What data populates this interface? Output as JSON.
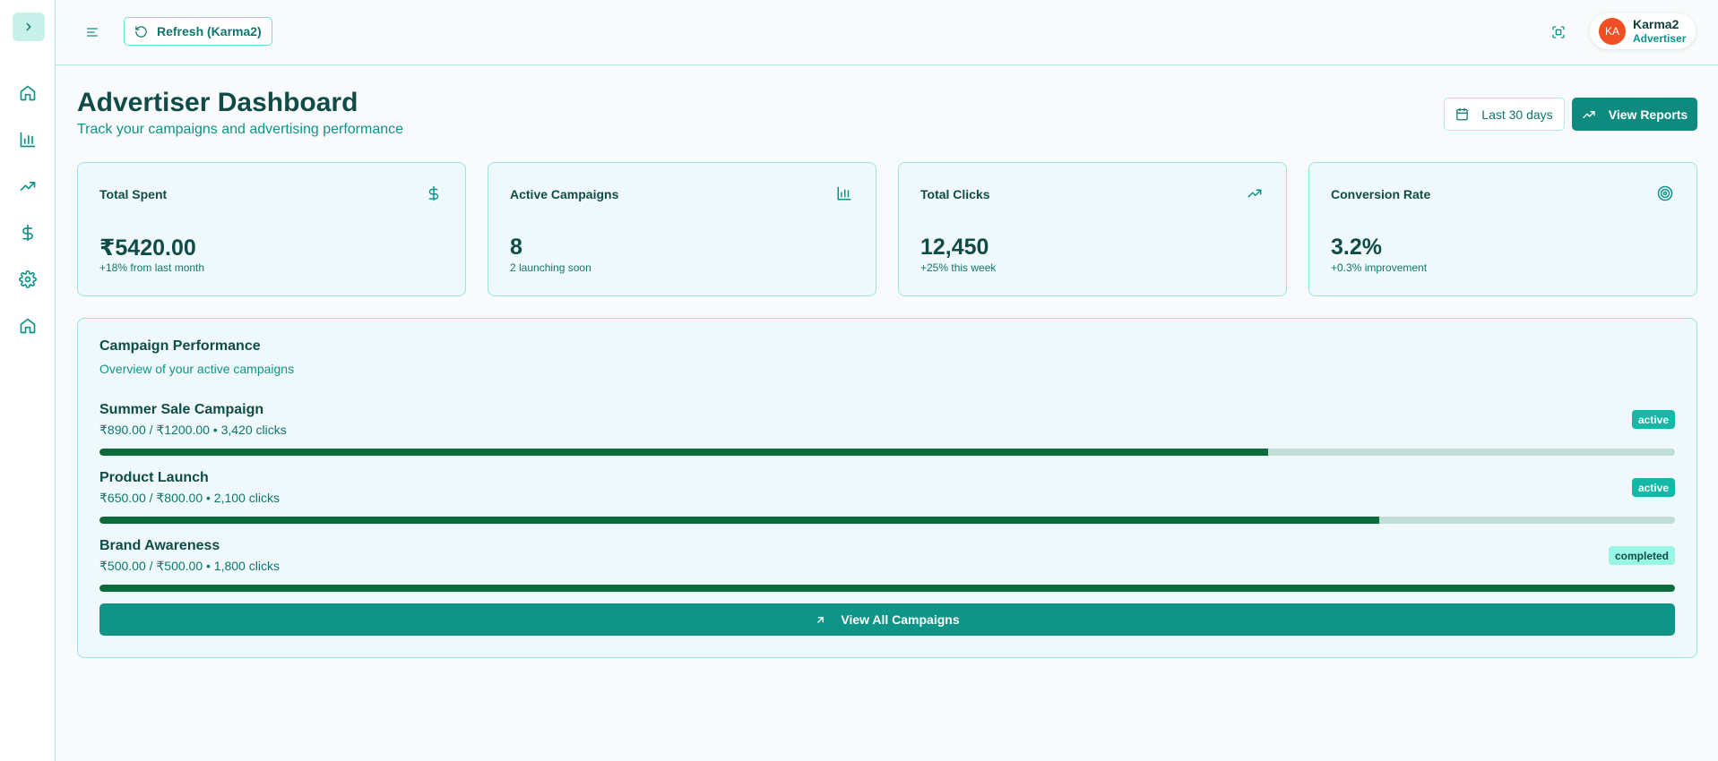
{
  "header": {
    "refresh_label": "Refresh (Karma2)",
    "user": {
      "initials": "KA",
      "name": "Karma2",
      "role": "Advertiser"
    }
  },
  "sidebar": {
    "items": [
      {
        "icon": "home-icon"
      },
      {
        "icon": "bar-chart-icon"
      },
      {
        "icon": "trending-up-icon"
      },
      {
        "icon": "dollar-icon"
      },
      {
        "icon": "gear-icon"
      },
      {
        "icon": "home-icon"
      }
    ]
  },
  "page": {
    "title": "Advertiser Dashboard",
    "subtitle": "Track your campaigns and advertising performance",
    "date_range_label": "Last 30 days",
    "reports_label": "View Reports"
  },
  "stats": [
    {
      "label": "Total Spent",
      "value": "₹5420.00",
      "sub": "+18% from last month",
      "icon": "dollar-icon"
    },
    {
      "label": "Active Campaigns",
      "value": "8",
      "sub": "2 launching soon",
      "icon": "bar-chart-icon"
    },
    {
      "label": "Total Clicks",
      "value": "12,450",
      "sub": "+25% this week",
      "icon": "trending-up-icon"
    },
    {
      "label": "Conversion Rate",
      "value": "3.2%",
      "sub": "+0.3% improvement",
      "icon": "target-icon"
    }
  ],
  "campaigns": {
    "title": "Campaign Performance",
    "subtitle": "Overview of your active campaigns",
    "items": [
      {
        "name": "Summer Sale Campaign",
        "meta": "₹890.00 / ₹1200.00 • 3,420 clicks",
        "status": "active",
        "progress": 0.742
      },
      {
        "name": "Product Launch",
        "meta": "₹650.00 / ₹800.00 • 2,100 clicks",
        "status": "active",
        "progress": 0.8125
      },
      {
        "name": "Brand Awareness",
        "meta": "₹500.00 / ₹500.00 • 1,800 clicks",
        "status": "completed",
        "progress": 1.0
      }
    ],
    "view_all_label": "View All Campaigns"
  },
  "colors": {
    "accent": "#0f9488",
    "progress": "#0b6b3a",
    "avatar": "#f04e23"
  }
}
